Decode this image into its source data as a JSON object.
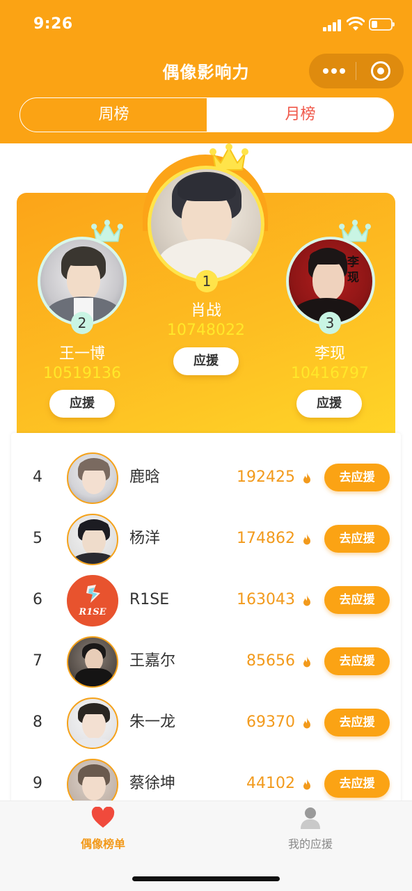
{
  "status_bar": {
    "time": "9:26"
  },
  "nav": {
    "title": "偶像影响力"
  },
  "tabs": [
    {
      "label": "周榜",
      "active": false
    },
    {
      "label": "月榜",
      "active": true
    }
  ],
  "top3": [
    {
      "rank": "1",
      "name": "肖战",
      "score": "10748022",
      "button": "应援"
    },
    {
      "rank": "2",
      "name": "王一博",
      "score": "10519136",
      "button": "应援"
    },
    {
      "rank": "3",
      "name": "李现",
      "score": "10416797",
      "button": "应援"
    }
  ],
  "list": [
    {
      "rank": "4",
      "name": "鹿晗",
      "score": "192425",
      "button": "去应援"
    },
    {
      "rank": "5",
      "name": "杨洋",
      "score": "174862",
      "button": "去应援"
    },
    {
      "rank": "6",
      "name": "R1SE",
      "score": "163043",
      "button": "去应援"
    },
    {
      "rank": "7",
      "name": "王嘉尔",
      "score": "85656",
      "button": "去应援"
    },
    {
      "rank": "8",
      "name": "朱一龙",
      "score": "69370",
      "button": "去应援"
    },
    {
      "rank": "9",
      "name": "蔡徐坤",
      "score": "44102",
      "button": "去应援"
    }
  ],
  "avatar_logo_text": "R1SE",
  "li_xian_stamp": "李现",
  "tabbar": [
    {
      "label": "偶像榜单",
      "icon": "heart-icon",
      "active": true
    },
    {
      "label": "我的应援",
      "icon": "user-icon",
      "active": false
    }
  ],
  "colors": {
    "brand_orange": "#fba314",
    "active_tab_text": "#f0584a",
    "score_yellow": "#ffe82a",
    "list_score": "#f29a1c",
    "tabbar_active": "#f29a1c"
  }
}
